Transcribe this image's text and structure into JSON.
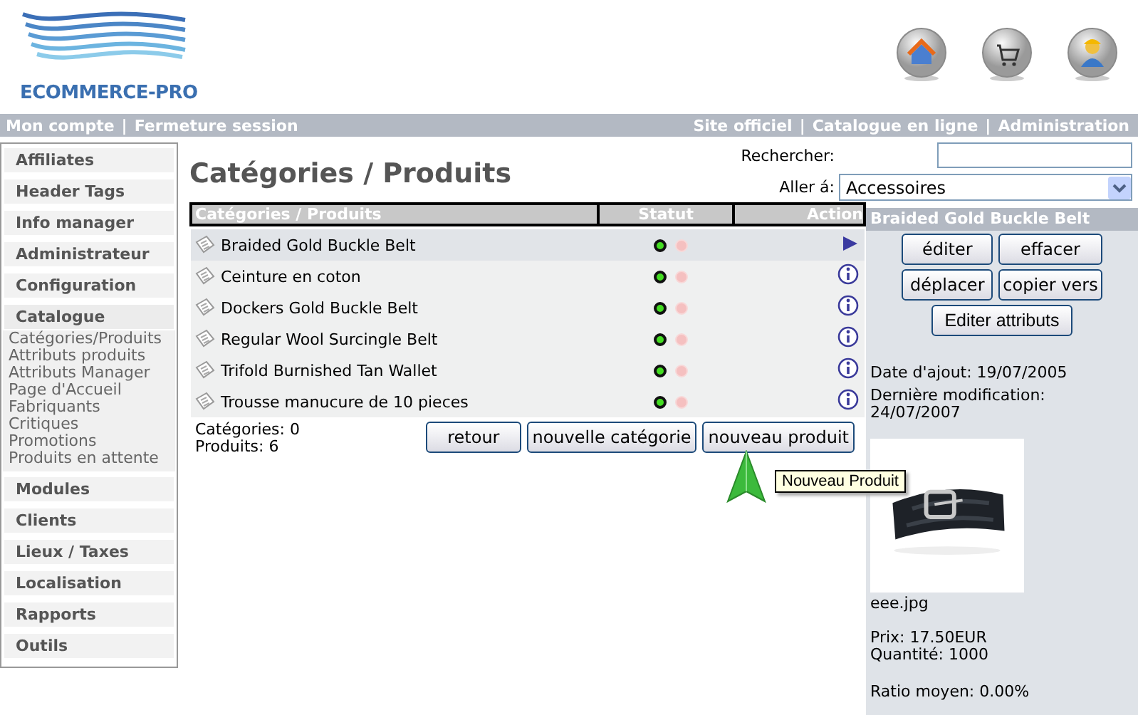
{
  "header": {
    "logo": "ECOMMERCE-PRO"
  },
  "top_nav": {
    "separator": "|",
    "left": [
      "Mon compte",
      "Fermeture session"
    ],
    "right": [
      "Site officiel",
      "Catalogue en ligne",
      "Administration"
    ]
  },
  "sidebar": {
    "items": [
      {
        "label": "Affiliates"
      },
      {
        "label": "Header Tags"
      },
      {
        "label": "Info manager"
      },
      {
        "label": "Administrateur"
      },
      {
        "label": "Configuration"
      },
      {
        "label": "Catalogue",
        "children": [
          "Catégories/Produits",
          "Attributs produits",
          "Attributs Manager",
          "Page d'Accueil",
          "Fabriquants",
          "Critiques",
          "Promotions",
          "Produits en attente"
        ]
      },
      {
        "label": "Modules"
      },
      {
        "label": "Clients"
      },
      {
        "label": "Lieux / Taxes"
      },
      {
        "label": "Localisation"
      },
      {
        "label": "Rapports"
      },
      {
        "label": "Outils"
      }
    ]
  },
  "page_title": "Catégories / Produits",
  "search": {
    "label": "Rechercher:"
  },
  "goto": {
    "label": "Aller á:",
    "value": "Accessoires"
  },
  "table": {
    "columns": [
      "Catégories / Produits",
      "Statut",
      "Action"
    ],
    "rows": [
      {
        "name": "Braided Gold Buckle Belt",
        "active": true,
        "selected": true
      },
      {
        "name": "Ceinture en coton",
        "active": true,
        "selected": false
      },
      {
        "name": "Dockers Gold Buckle Belt",
        "active": true,
        "selected": false
      },
      {
        "name": "Regular Wool Surcingle Belt",
        "active": true,
        "selected": false
      },
      {
        "name": "Trifold Burnished Tan Wallet",
        "active": true,
        "selected": false
      },
      {
        "name": "Trousse manucure de 10 pieces",
        "active": true,
        "selected": false
      }
    ]
  },
  "counts": [
    "Catégories: 0",
    "Produits: 6"
  ],
  "buttons": [
    "retour",
    "nouvelle catégorie",
    "nouveau produit"
  ],
  "tooltip": "Nouveau Produit",
  "detail": {
    "title": "Braided Gold Buckle Belt",
    "buttons": [
      "éditer",
      "effacer",
      "déplacer",
      "copier vers",
      "Editer attributs"
    ],
    "date_added": "Date d'ajout: 19/07/2005",
    "last_modified": "Dernière modification: 24/07/2007",
    "image": {
      "kind": "picture"
    },
    "filename": "eee.jpg",
    "price": "Prix: 17.50EUR",
    "quantity": "Quantité: 1000",
    "rating": "Ratio moyen: 0.00%"
  }
}
